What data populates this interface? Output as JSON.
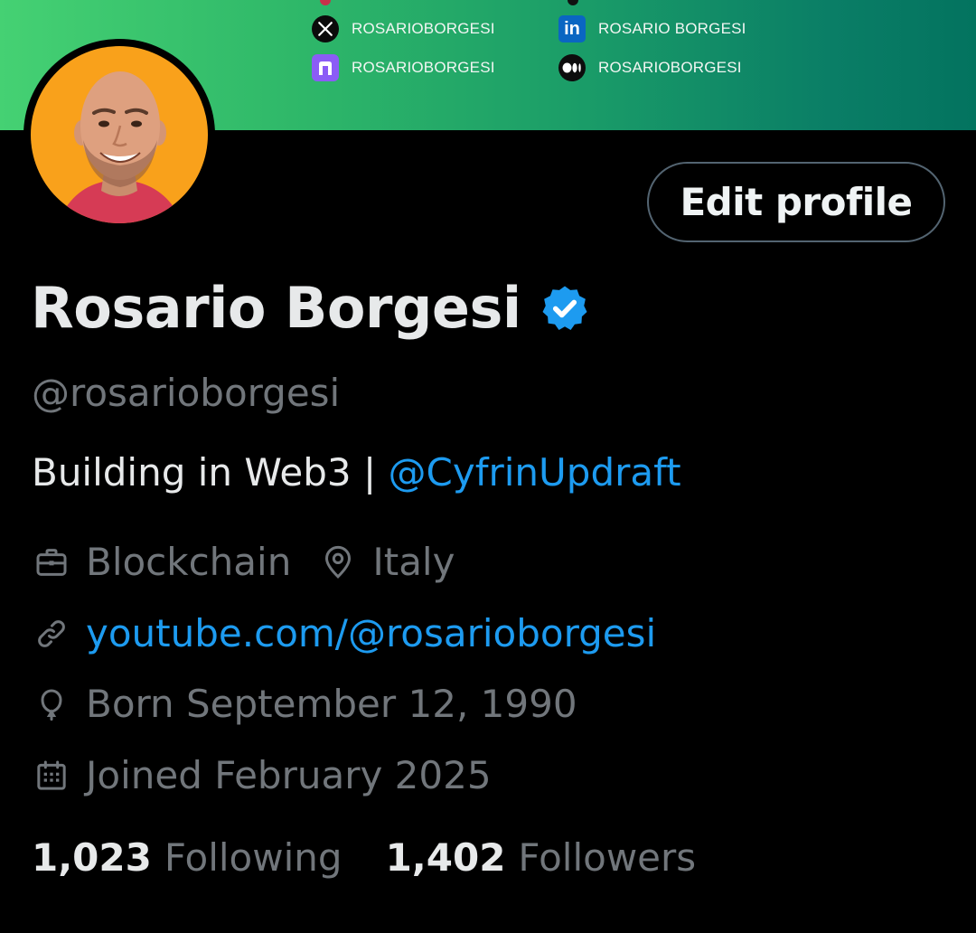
{
  "banner": {
    "socials": [
      {
        "icon": "x-logo-icon",
        "label": "ROSARIOBORGESI"
      },
      {
        "icon": "linkedin-logo-icon",
        "label": "ROSARIO BORGESI"
      },
      {
        "icon": "arc-logo-icon",
        "label": "ROSARIOBORGESI"
      },
      {
        "icon": "medium-logo-icon",
        "label": "ROSARIOBORGESI"
      }
    ],
    "gradient_start": "#45d173",
    "gradient_end": "#03735f"
  },
  "profile": {
    "edit_button": "Edit profile",
    "name": "Rosario Borgesi",
    "verified_color": "#1d9bf0",
    "handle": "@rosarioborgesi",
    "bio_text": "Building in Web3 | ",
    "bio_mention": "@CyfrinUpdraft",
    "category": "Blockchain",
    "location": "Italy",
    "website": "youtube.com/@rosarioborgesi",
    "birthday": "Born September 12, 1990",
    "joined": "Joined February 2025"
  },
  "stats": {
    "following_count": "1,023",
    "following_label": "Following",
    "followers_count": "1,402",
    "followers_label": "Followers"
  },
  "colors": {
    "background": "#000000",
    "primary_text": "#e7e9ea",
    "secondary_text": "#71767b",
    "link": "#1d9bf0",
    "avatar_bg": "#f9a11b"
  }
}
